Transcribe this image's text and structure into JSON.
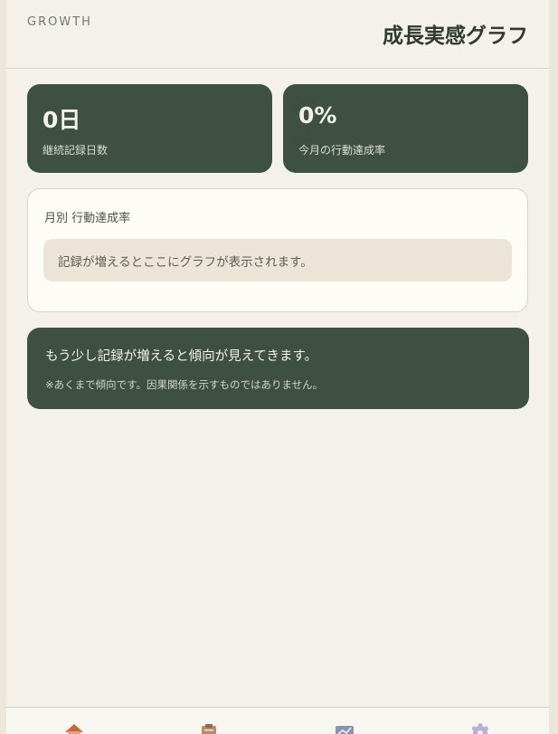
{
  "header": {
    "eyebrow": "GROWTH",
    "title": "成長実感グラフ"
  },
  "stats": {
    "streak": {
      "value": "0日",
      "label": "継続記録日数"
    },
    "achievement": {
      "value": "0%",
      "label": "今月の行動達成率"
    }
  },
  "chart": {
    "title": "月別 行動達成率",
    "empty_message": "記録が増えるとここにグラフが表示されます。"
  },
  "insight": {
    "message": "もう少し記録が増えると傾向が見えてきます。",
    "note": "※あくまで傾向です。因果関係を示すものではありません。"
  },
  "nav": {
    "items": [
      {
        "icon": "home-icon"
      },
      {
        "icon": "clipboard-icon"
      },
      {
        "icon": "chart-icon"
      },
      {
        "icon": "gear-icon"
      }
    ]
  }
}
